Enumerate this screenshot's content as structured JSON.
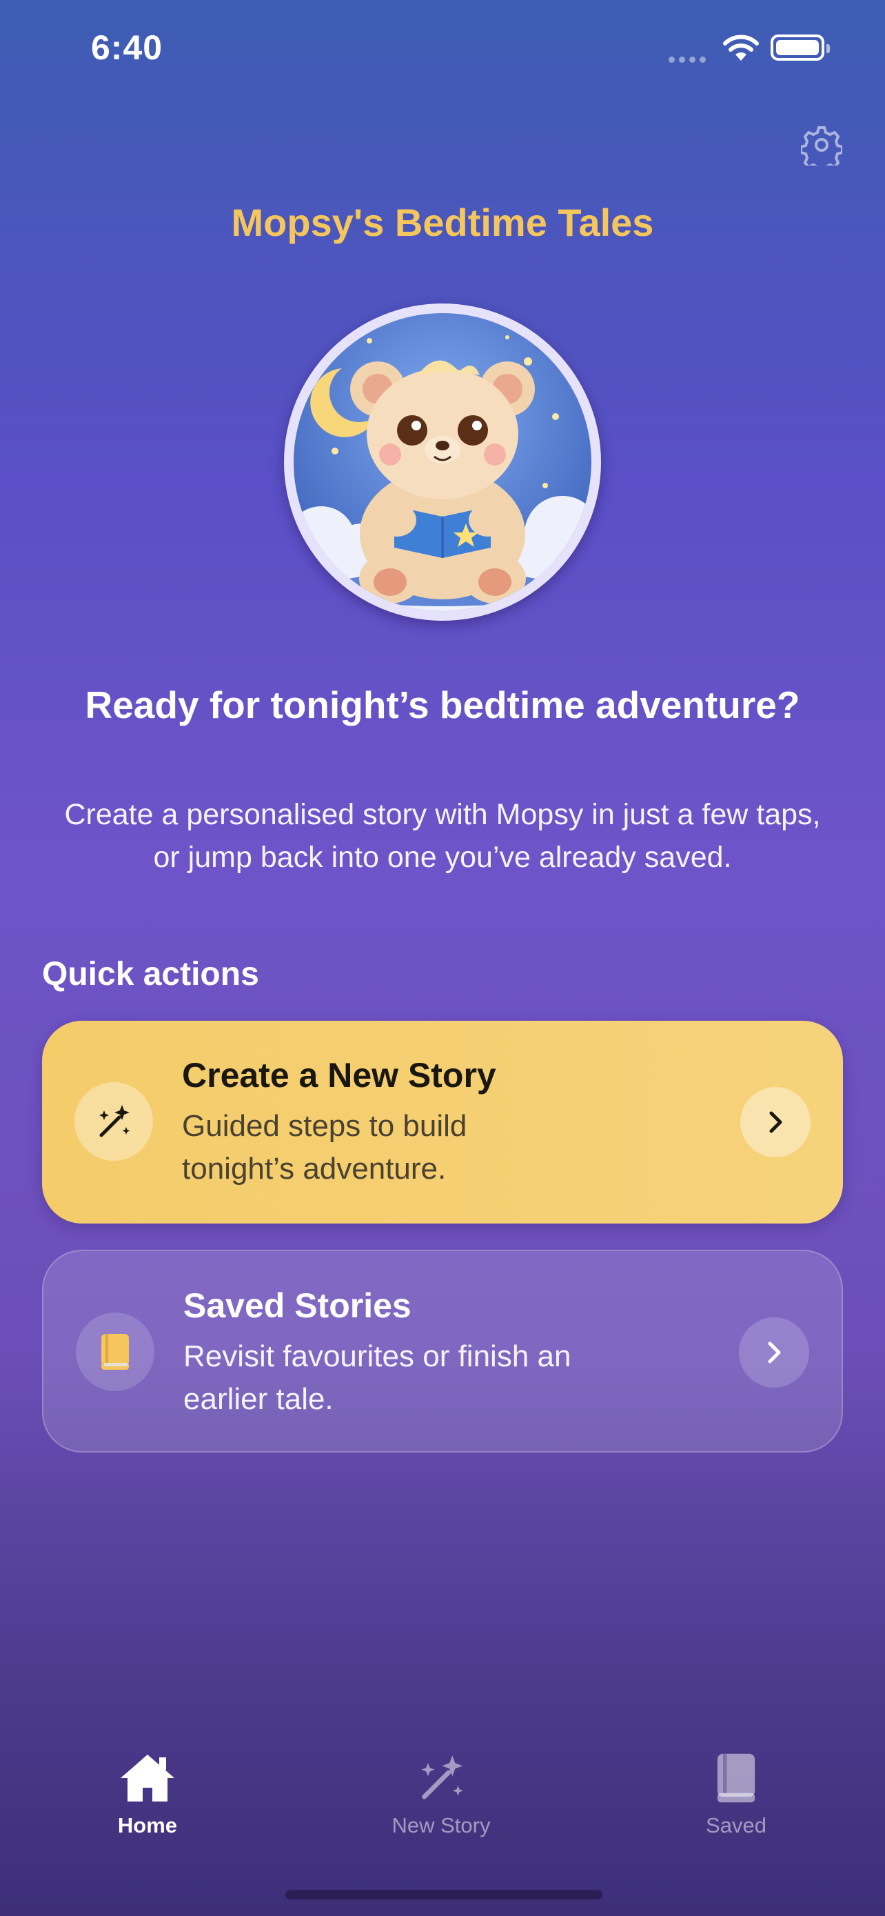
{
  "status_bar": {
    "time": "6:40"
  },
  "header": {
    "title": "Mopsy's Bedtime Tales",
    "settings_icon": "gear-icon"
  },
  "hero": {
    "avatar": "teddy-bear-reading-illustration",
    "headline": "Ready for tonight’s bedtime adventure?",
    "subtext_line1": "Create a personalised story with Mopsy in just a few taps,",
    "subtext_line2": "or jump back into one you’ve already saved."
  },
  "quick_actions": {
    "label": "Quick actions",
    "create": {
      "title": "Create a New Story",
      "desc_line1": "Guided steps to build",
      "desc_line2": "tonight’s adventure.",
      "icon": "magic-wand-icon"
    },
    "saved": {
      "title": "Saved Stories",
      "desc_line1": "Revisit favourites or finish an",
      "desc_line2": "earlier tale.",
      "icon": "book-icon"
    }
  },
  "tab_bar": {
    "home": "Home",
    "new_story": "New Story",
    "saved": "Saved"
  },
  "colors": {
    "accent_yellow": "#f4c65c",
    "card_yellow": "#f5ce6e",
    "background_top": "#3d5db3",
    "background_mid": "#6e54c8"
  }
}
